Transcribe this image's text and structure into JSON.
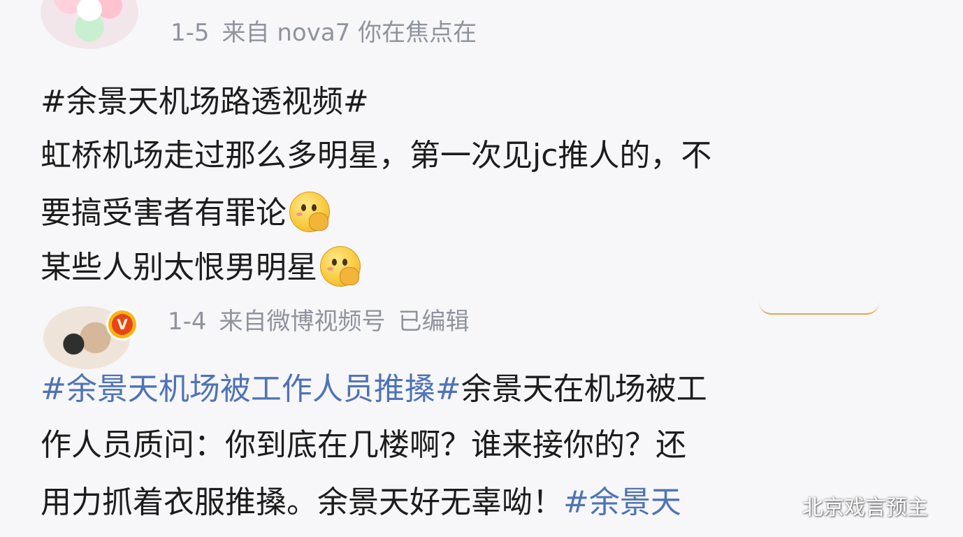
{
  "post1": {
    "meta": {
      "date": "1-5",
      "source": "来自 nova7 你在焦点在"
    },
    "tagline": "#余景天机场路透视频#",
    "line1": "虹桥机场走过那么多明星，第一次见jc推人的，不",
    "line2": "要搞受害者有罪论",
    "line3": "某些人别太恨男明星",
    "emoji_icon": "thinking-face-emoji"
  },
  "post2": {
    "meta": {
      "date": "1-4",
      "source": "来自微博视频号",
      "edited": "已编辑"
    },
    "verified_badge": "V",
    "line1": {
      "tag": "#余景天机场被工作人员推搡#",
      "text": "余景天在机场被工"
    },
    "line2": "作人员质问：你到底在几楼啊？谁来接你的？还",
    "line3": {
      "text": "用力抓着衣服推搡。余景天好无辜呦！",
      "tag": "#余景天"
    }
  },
  "watermark": "北京戏言预主",
  "colors": {
    "background": "#f7f7f9",
    "hashtag": "#4f73b5",
    "meta_text": "#8f939d",
    "body_text": "#1c1c1c",
    "verified_badge": "#f6b511"
  }
}
